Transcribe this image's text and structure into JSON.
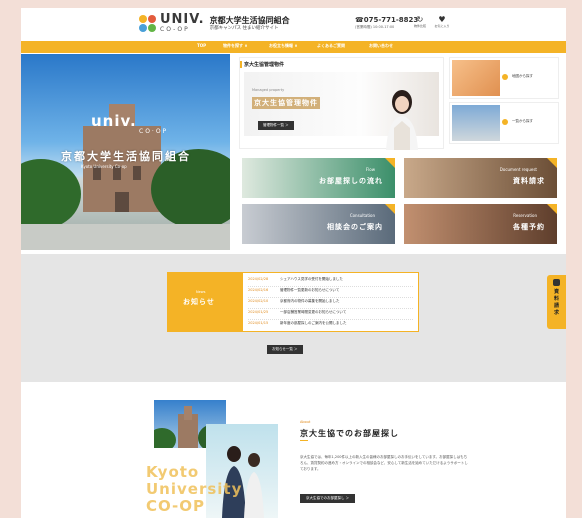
{
  "colors": {
    "accent": "#f4b326",
    "dark": "#333333",
    "bg": "#f3dfd7"
  },
  "header": {
    "logo_word": "UNIV.",
    "logo_sub": "CO-OP",
    "logo_jp": "京都大学生活協同組合",
    "logo_jp_sub": "京都キャンパス 住まい紹介サイト",
    "phone": "075-771-8823",
    "phone_note": "(営業時間) 10:00-17:00",
    "icons": [
      {
        "glyph": "↻",
        "label": "物件比較"
      },
      {
        "glyph": "♥",
        "label": "お気に入り"
      }
    ]
  },
  "nav": [
    "TOP",
    "物件を探す ∨",
    "お役立ち情報 ∨",
    "よくあるご質問",
    "お問い合わせ"
  ],
  "hero": {
    "logo": "univ.",
    "co": "CO·OP",
    "jp": "京都大学生活協同組合",
    "sub": "Kyoto University Co-op"
  },
  "property": {
    "title": "京大生協管理物件",
    "label": "Managed property",
    "big": "京大生協管理物件",
    "btn": "管理物件一覧 ＞"
  },
  "side_cards": [
    {
      "text": "地図から探す"
    },
    {
      "text": "一覧から探す"
    }
  ],
  "tiles": [
    {
      "en": "Flow",
      "jp": "お部屋探しの流れ",
      "color": "#3b8f6a"
    },
    {
      "en": "Document request",
      "jp": "資料請求",
      "color": "#8a6a4a"
    },
    {
      "en": "Consultation",
      "jp": "相談会のご案内",
      "color": "#5a6a7a"
    },
    {
      "en": "Reservation",
      "jp": "各種予約",
      "color": "#6b4a3a"
    }
  ],
  "news": {
    "en": "News",
    "jp": "お知らせ",
    "items": [
      {
        "date": "2024/02/28",
        "text": "シェアハウス見学の受付を開始しました"
      },
      {
        "date": "2024/02/16",
        "text": "管理物件一覧更新のお知らせについて"
      },
      {
        "date": "2024/02/10",
        "text": "京都府内の物件の募集を開始しました"
      },
      {
        "date": "2024/01/25",
        "text": "一部店舗営業時間変更のお知らせについて"
      },
      {
        "date": "2024/01/15",
        "text": "新年度の部屋探しのご案内を公開しました"
      }
    ],
    "btn": "お知らせ一覧 ＞"
  },
  "side_tab": {
    "text": "資料請求"
  },
  "about": {
    "kyoto": "Kyoto University CO-OP",
    "en": "About",
    "title": "京大生協でのお部屋探し",
    "body": "京大生協では、毎年1,200件以上の新入生の皆様のお部屋探しのお手伝いをしています。お部屋探しはもちろん、賃貸契約の進め方・オンラインでの相談会など、安心して新生活を始めていただけるようサポートしております。",
    "btn": "京大生協でのお部屋探し ＞"
  }
}
